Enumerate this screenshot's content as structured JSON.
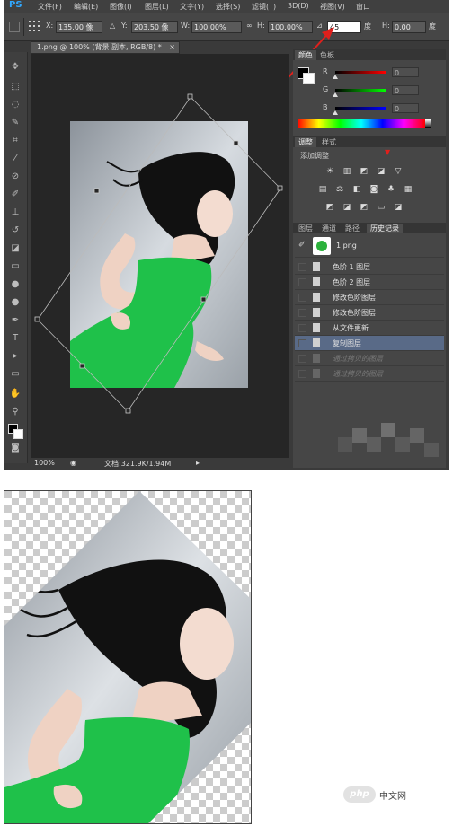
{
  "menubar": {
    "logo": "PS",
    "items": [
      "文件(F)",
      "编辑(E)",
      "图像(I)",
      "图层(L)",
      "文字(Y)",
      "选择(S)",
      "滤镜(T)",
      "3D(D)",
      "视图(V)",
      "窗口"
    ]
  },
  "options": {
    "x_label": "X:",
    "x_value": "135.00 像",
    "y_label": "Y:",
    "y_value": "203.50 像",
    "w_label": "W:",
    "w_value": "100.00%",
    "h_label": "H:",
    "h_value": "100.00%",
    "angle_value": "45",
    "degree_label": "度",
    "hskew_label": "H:",
    "hskew_value": "0.00",
    "hskew_unit": "度"
  },
  "document": {
    "tab_title": "1.png @ 100% (背景 副本, RGB/8) *",
    "zoom": "100%",
    "doc_info": "文档:321.9K/1.94M"
  },
  "color_panel": {
    "tabs": [
      "颜色",
      "色板"
    ],
    "channels": [
      {
        "label": "R",
        "value": "0"
      },
      {
        "label": "G",
        "value": "0"
      },
      {
        "label": "B",
        "value": "0"
      }
    ]
  },
  "adjust_panel": {
    "tabs": [
      "调整",
      "样式"
    ],
    "subtitle": "添加调整"
  },
  "history_panel": {
    "tabs": [
      "图层",
      "通道",
      "路径",
      "历史记录"
    ],
    "snapshot": "1.png",
    "items": [
      {
        "label": "色阶 1 图层",
        "state": "normal"
      },
      {
        "label": "色阶 2 图层",
        "state": "normal"
      },
      {
        "label": "修改色阶图层",
        "state": "normal"
      },
      {
        "label": "修改色阶图层",
        "state": "normal"
      },
      {
        "label": "从文件更新",
        "state": "normal"
      },
      {
        "label": "复制图层",
        "state": "selected"
      },
      {
        "label": "通过拷贝的图层",
        "state": "dim"
      },
      {
        "label": "通过拷贝的图层",
        "state": "dim"
      }
    ]
  },
  "watermark": {
    "badge": "php",
    "text": "中文网"
  },
  "colors": {
    "dress_green": "#1fc14a",
    "arrow_red": "#e0201c",
    "history_selected": "#596a87",
    "photo_background": "#c2c8ce"
  },
  "icons": {
    "move_tool": "move-icon",
    "marquee": "marquee-icon",
    "lasso": "lasso-icon",
    "crop": "crop-icon",
    "eyedropper": "eyedropper-icon",
    "brush": "brush-icon",
    "type": "type-icon",
    "hand": "hand-icon",
    "zoom": "zoom-icon"
  }
}
